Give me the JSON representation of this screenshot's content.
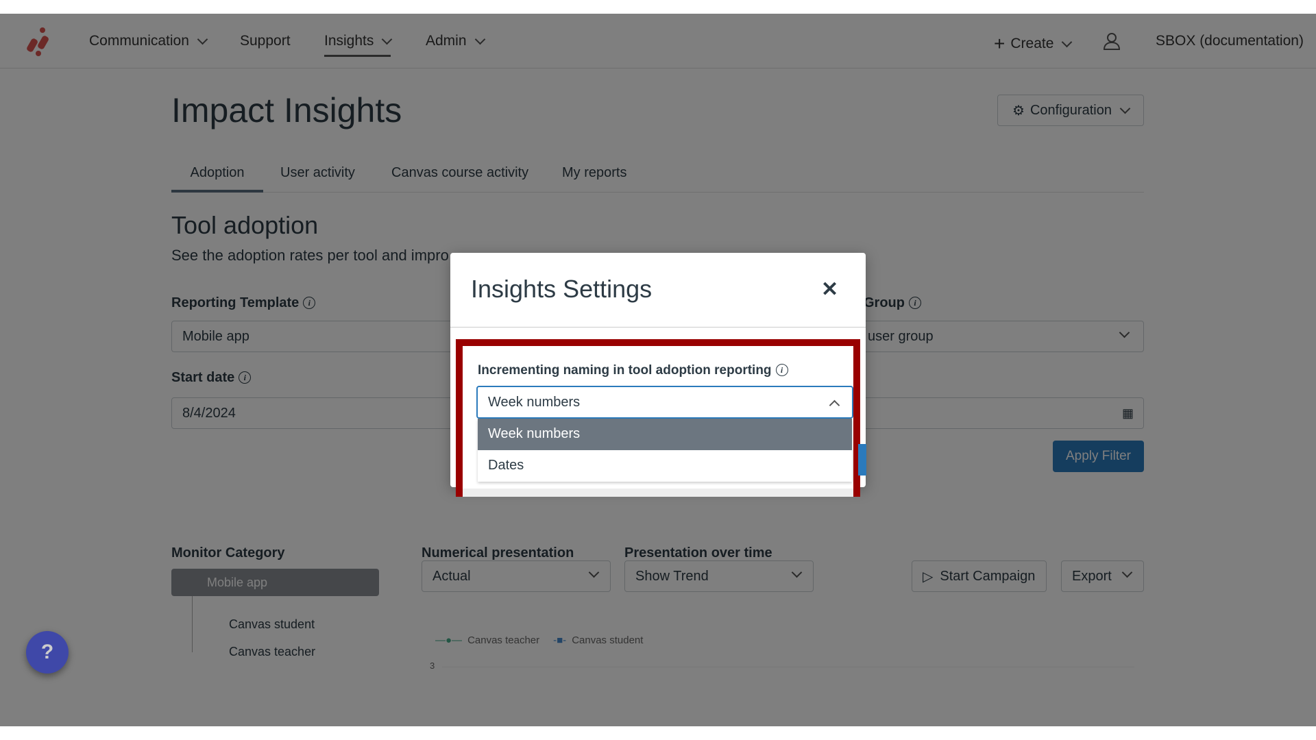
{
  "nav": {
    "items": [
      {
        "label": "Communication",
        "has_menu": true
      },
      {
        "label": "Support",
        "has_menu": false
      },
      {
        "label": "Insights",
        "has_menu": true,
        "active": true
      },
      {
        "label": "Admin",
        "has_menu": true
      }
    ],
    "create_label": "Create",
    "account_label": "SBOX (documentation)"
  },
  "header": {
    "title": "Impact Insights",
    "configuration_label": "Configuration"
  },
  "tabs": [
    {
      "label": "Adoption",
      "active": true
    },
    {
      "label": "User activity"
    },
    {
      "label": "Canvas course activity"
    },
    {
      "label": "My reports"
    }
  ],
  "section": {
    "title": "Tool adoption",
    "subtitle": "See the adoption rates per tool and impro"
  },
  "filters": {
    "reporting_template_label": "Reporting Template",
    "reporting_template_value": "Mobile app",
    "group_label": "Group",
    "group_value": "user group",
    "start_date_label": "Start date",
    "start_date_value": "8/4/2024",
    "apply_label": "Apply Filter"
  },
  "monitor": {
    "label": "Monitor Category",
    "items": [
      "Mobile app",
      "Canvas student",
      "Canvas teacher"
    ]
  },
  "controls": {
    "numerical_label": "Numerical presentation",
    "numerical_value": "Actual",
    "time_label": "Presentation over time",
    "time_value": "Show Trend",
    "campaign_label": "Start Campaign",
    "export_label": "Export"
  },
  "chart": {
    "legend": [
      "Canvas teacher",
      "Canvas student"
    ],
    "y_tick": "3"
  },
  "modal": {
    "title": "Insights Settings",
    "field_label": "Incrementing naming in tool adoption reporting",
    "selected": "Week numbers",
    "options": [
      "Week numbers",
      "Dates"
    ]
  },
  "colors": {
    "highlight": "#990000",
    "option_selected": "#6c7680",
    "help": "#3f48a8",
    "accent": "#2b7abc"
  }
}
